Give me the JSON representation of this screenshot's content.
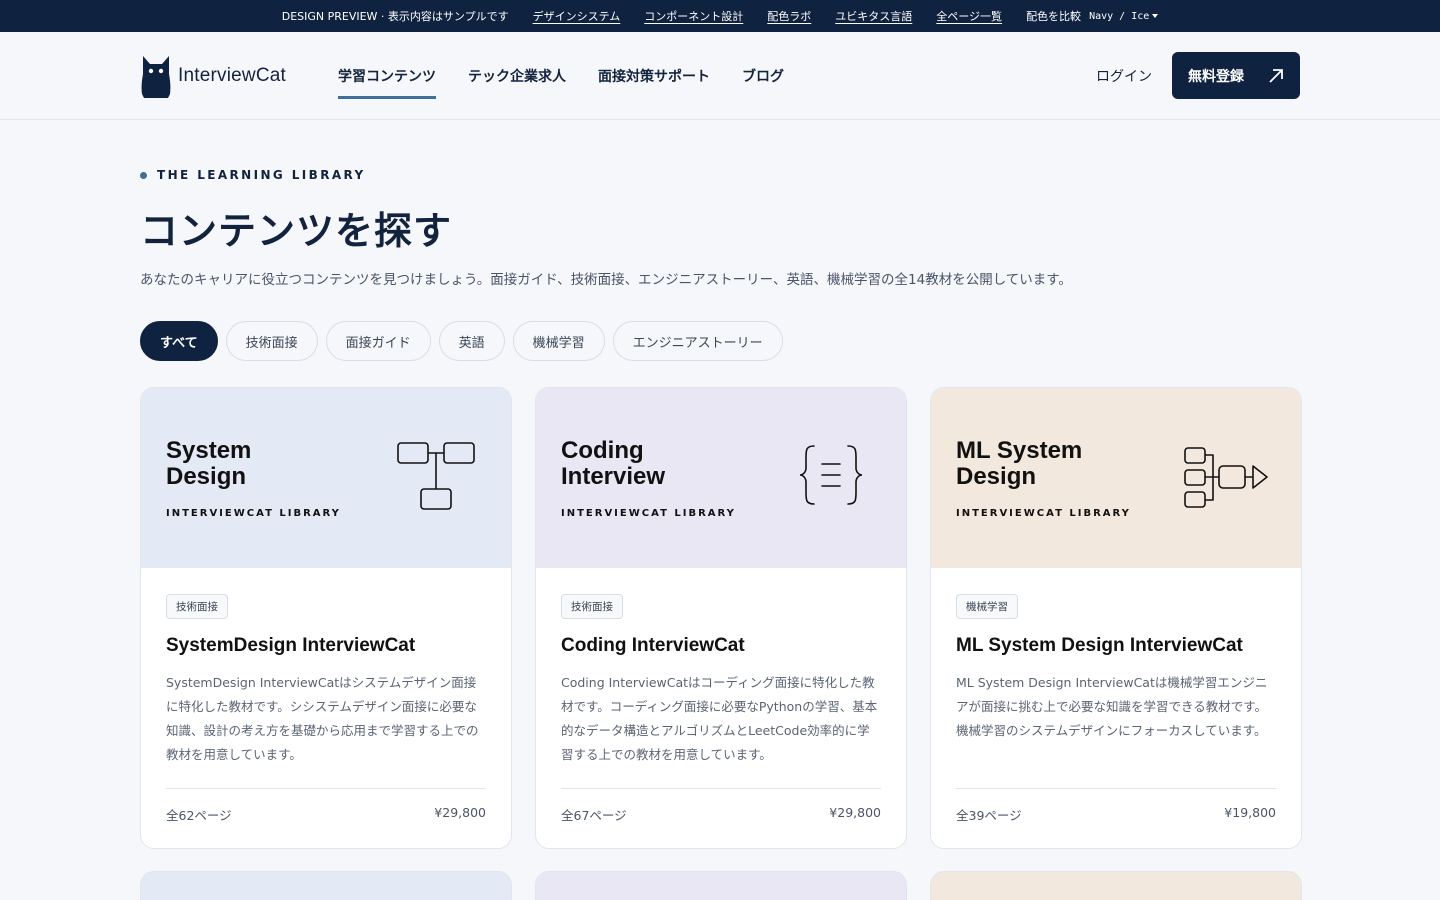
{
  "topbar": {
    "preview": "DESIGN PREVIEW · 表示内容はサンプルです",
    "links": [
      "デザインシステム",
      "コンポーネント設計",
      "配色ラボ",
      "ユビキタス言語",
      "全ページ一覧"
    ],
    "compare_label": "配色を比較",
    "compare_value": "Navy / Ice"
  },
  "header": {
    "logo": "InterviewCat",
    "nav": [
      "学習コンテンツ",
      "テック企業求人",
      "面接対策サポート",
      "ブログ"
    ],
    "login": "ログイン",
    "signup": "無料登録"
  },
  "hero": {
    "eyebrow": "THE LEARNING LIBRARY",
    "title": "コンテンツを探す",
    "description": "あなたのキャリアに役立つコンテンツを見つけましょう。面接ガイド、技術面接、エンジニアストーリー、英語、機械学習の全14教材を公開しています。"
  },
  "filters": [
    "すべて",
    "技術面接",
    "面接ガイド",
    "英語",
    "機械学習",
    "エンジニアストーリー"
  ],
  "cards": [
    {
      "cover_line1": "System",
      "cover_line2": "Design",
      "cover_sub": "INTERVIEWCAT LIBRARY",
      "tag": "技術面接",
      "title": "SystemDesign InterviewCat",
      "description": "SystemDesign InterviewCatはシステムデザイン面接に特化した教材です。シシステムデザイン面接に必要な知識、設計の考え方を基礎から応用まで学習する上での教材を用意しています。",
      "pages": "全62ページ",
      "price": "¥29,800",
      "bg": "#e3eaf5"
    },
    {
      "cover_line1": "Coding",
      "cover_line2": "Interview",
      "cover_sub": "INTERVIEWCAT LIBRARY",
      "tag": "技術面接",
      "title": "Coding InterviewCat",
      "description": "Coding InterviewCatはコーディング面接に特化した教材です。コーディング面接に必要なPythonの学習、基本的なデータ構造とアルゴリズムとLeetCode効率的に学習する上での教材を用意しています。",
      "pages": "全67ページ",
      "price": "¥29,800",
      "bg": "#e9e7f3"
    },
    {
      "cover_line1": "ML System",
      "cover_line2": "Design",
      "cover_sub": "INTERVIEWCAT LIBRARY",
      "tag": "機械学習",
      "title": "ML System Design InterviewCat",
      "description": "ML System Design InterviewCatは機械学習エンジニアが面接に挑む上で必要な知識を学習できる教材です。機械学習のシステムデザインにフォーカスしています。",
      "pages": "全39ページ",
      "price": "¥19,800",
      "bg": "#f3e8dd"
    }
  ]
}
